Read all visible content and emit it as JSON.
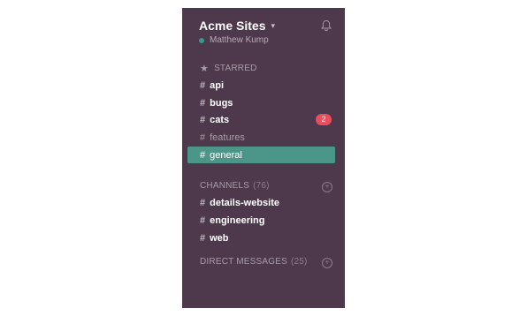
{
  "team": {
    "name": "Acme Sites",
    "chevron": "⌄",
    "icon": "bell-icon"
  },
  "user": {
    "name": "Matthew Kump",
    "presence_color": "#38978d"
  },
  "starred": {
    "title": "STARRED",
    "icon": "star-icon",
    "items": [
      {
        "name": "api"
      },
      {
        "name": "bugs"
      },
      {
        "name": "cats",
        "badge": "2"
      },
      {
        "name": "features"
      },
      {
        "name": "general"
      }
    ]
  },
  "channels": {
    "title": "CHANNELS",
    "count": "(76)",
    "items": [
      {
        "name": "details-website"
      },
      {
        "name": "engineering"
      },
      {
        "name": "web"
      }
    ]
  },
  "direct_messages": {
    "title": "DIRECT MESSAGES",
    "count": "(25)"
  },
  "colors": {
    "sidebar_bg": "#4d394b",
    "active_item": "#4c9689",
    "badge": "#eb4d5c"
  }
}
